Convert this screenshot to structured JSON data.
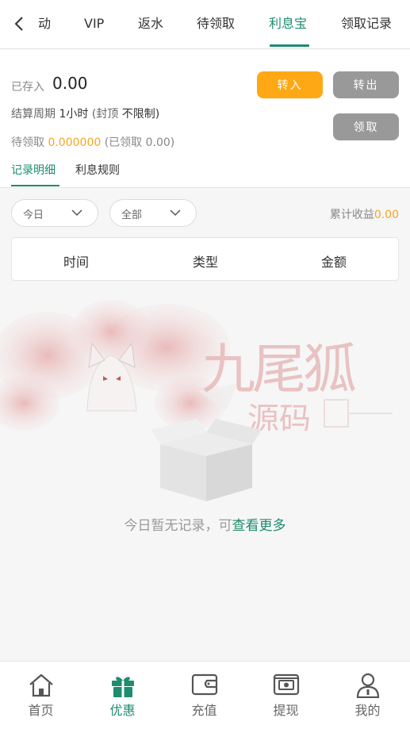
{
  "header": {
    "tabs": [
      {
        "label": "动"
      },
      {
        "label": "VIP"
      },
      {
        "label": "返水"
      },
      {
        "label": "待领取"
      },
      {
        "label": "利息宝"
      },
      {
        "label": "领取记录"
      }
    ],
    "active_tab": "利息宝"
  },
  "summary": {
    "deposited_label": "已存入",
    "deposited_value": "0.00",
    "period_label": "结算周期",
    "period_value": "1小时",
    "cap_label": "(封顶",
    "cap_value": "不限制)",
    "pending_label": "待领取",
    "pending_value": "0.000000",
    "claimed_text": "(已领取 0.00)",
    "btn_in": "转入",
    "btn_out": "转出",
    "btn_claim": "领取"
  },
  "subtabs": [
    {
      "label": "记录明细"
    },
    {
      "label": "利息规则"
    }
  ],
  "filters": {
    "date_value": "今日",
    "type_value": "全部",
    "total_label": "累计收益",
    "total_value": "0.00"
  },
  "table": {
    "columns": [
      "时间",
      "类型",
      "金额"
    ]
  },
  "watermark": {
    "title": "九尾狐",
    "subtitle": "源码"
  },
  "empty": {
    "text": "今日暂无记录，可",
    "link": "查看更多"
  },
  "bottom_nav": [
    {
      "label": "首页",
      "icon": "home-icon"
    },
    {
      "label": "优惠",
      "icon": "gift-icon"
    },
    {
      "label": "充值",
      "icon": "wallet-icon"
    },
    {
      "label": "提现",
      "icon": "withdraw-icon"
    },
    {
      "label": "我的",
      "icon": "user-icon"
    }
  ],
  "colors": {
    "accent": "#1e8c6e",
    "orange": "#f5a623",
    "button_orange": "#ffa816",
    "button_gray": "#999999"
  }
}
